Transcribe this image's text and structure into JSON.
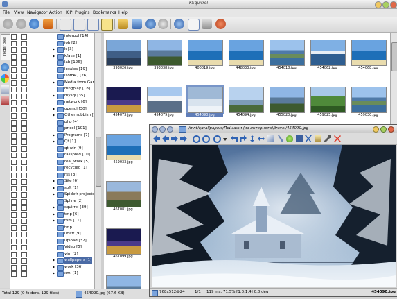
{
  "window": {
    "title": "KSquirrel"
  },
  "menu": [
    "File",
    "View",
    "Navigator",
    "Action",
    "KIPI Plugins",
    "Bookmarks",
    "Help"
  ],
  "colors": {
    "selection": "#4a6aa5",
    "folder": "#7aa3dc",
    "close_button": "#d44a2c"
  },
  "toolbar": {
    "icons": [
      "back-icon",
      "forward-icon",
      "up-icon",
      "home-icon",
      "view-icons-icon",
      "view-details-icon",
      "view-list-icon",
      "view-thumbnails-icon",
      "open-viewer-icon",
      "slideshow-icon",
      "convert-icon",
      "find-icon",
      "configure-icon",
      "select-icon",
      "info-icon",
      "edit-icon",
      "about-icon"
    ]
  },
  "left_tabs": {
    "folder_tree": "Folder tree"
  },
  "tree": {
    "items": [
      {
        "label": "interpol [14]",
        "arrow": false
      },
      {
        "label": "job [2]",
        "arrow": false
      },
      {
        "label": "k [3]",
        "arrow": true
      },
      {
        "label": "kfake [1]",
        "arrow": true
      },
      {
        "label": "lab [126]",
        "arrow": false
      },
      {
        "label": "locales [19]",
        "arrow": false
      },
      {
        "label": "lsofFAQ [26]",
        "arrow": false
      },
      {
        "label": "Media from Games...",
        "arrow": true
      },
      {
        "label": "mngplay [18]",
        "arrow": false
      },
      {
        "label": "mysql [35]",
        "arrow": true
      },
      {
        "label": "network [6]",
        "arrow": false
      },
      {
        "label": "opengl [30]",
        "arrow": true
      },
      {
        "label": "Other rubbish [23]",
        "arrow": true
      },
      {
        "label": "php [4]",
        "arrow": false
      },
      {
        "label": "pricol [101]",
        "arrow": false
      },
      {
        "label": "Programs [7]",
        "arrow": true
      },
      {
        "label": "Qt [1]",
        "arrow": true
      },
      {
        "label": "qt-win [9]",
        "arrow": false
      },
      {
        "label": "rasspred [10]",
        "arrow": false
      },
      {
        "label": "real_work [5]",
        "arrow": false
      },
      {
        "label": "recycled [1]",
        "arrow": false
      },
      {
        "label": "rss [3]",
        "arrow": false
      },
      {
        "label": "Site [6]",
        "arrow": true
      },
      {
        "label": "soft [1]",
        "arrow": true
      },
      {
        "label": "Spidefr projects",
        "arrow": true
      },
      {
        "label": "Spline [2]",
        "arrow": false
      },
      {
        "label": "squirrel [39]",
        "arrow": true
      },
      {
        "label": "tmp [6]",
        "arrow": true
      },
      {
        "label": "tvm [11]",
        "arrow": true
      },
      {
        "label": "tmp",
        "arrow": false
      },
      {
        "label": "udaff [9]",
        "arrow": false
      },
      {
        "label": "upload [32]",
        "arrow": false
      },
      {
        "label": "Video [5]",
        "arrow": false
      },
      {
        "label": "vim [2]",
        "arrow": false
      },
      {
        "label": "wallpapers [1]",
        "arrow": true,
        "selected": true
      },
      {
        "label": "work [36]",
        "arrow": true
      },
      {
        "label": "xml [1]",
        "arrow": true
      }
    ]
  },
  "grid": {
    "thumbnails": [
      {
        "caption": "393026.jpg",
        "theme": "city"
      },
      {
        "caption": "393038.jpg",
        "theme": "mountain"
      },
      {
        "caption": "400019.jpg",
        "theme": "sea"
      },
      {
        "caption": "448033.jpg",
        "theme": "sea"
      },
      {
        "caption": "454018.jpg",
        "theme": "lake"
      },
      {
        "caption": "454062.jpg",
        "theme": "harbor"
      },
      {
        "caption": "454068.jpg",
        "theme": "sea"
      },
      {
        "caption": "454073.jpg",
        "theme": "night"
      },
      {
        "caption": "454079.jpg",
        "theme": "peak"
      },
      {
        "caption": "454090.jpg",
        "theme": "snow",
        "selected": true
      },
      {
        "caption": "454094.jpg",
        "theme": "cable"
      },
      {
        "caption": "455020.jpg",
        "theme": "mountain"
      },
      {
        "caption": "459025.jpg",
        "theme": "forest"
      },
      {
        "caption": "459030.jpg",
        "theme": "lake"
      },
      {
        "caption": "459033.jpg",
        "theme": "sea"
      },
      {
        "caption": "467081.jpg",
        "theme": "castle"
      },
      {
        "caption": "467099.jpg",
        "theme": "night"
      },
      {
        "caption": "",
        "theme": "mountain"
      }
    ]
  },
  "viewer": {
    "title": "/mnt/c/wallpapers/Пейзажи (из интернета)/travel/454090.jpg",
    "status": {
      "dims": "768x512@24",
      "page": "1/1",
      "info": "119 ms.  71.5% [1.0:1.4]  0.0 deg",
      "file": "454090.jpg"
    }
  },
  "status": {
    "text": "Total 129 (0 folders, 129 files)",
    "file": "454090.jpg (67.6 KB)"
  }
}
